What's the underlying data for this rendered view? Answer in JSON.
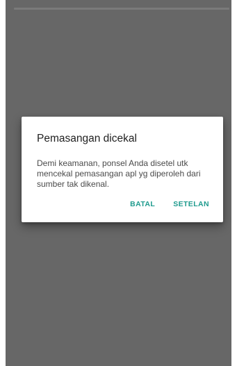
{
  "dialog": {
    "title": "Pemasangan dicekal",
    "message": "Demi keamanan, ponsel Anda disetel utk mencekal pemasangan apl yg diperoleh dari sumber tak dikenal.",
    "cancel_label": "BATAL",
    "settings_label": "SETELAN"
  },
  "colors": {
    "scrim": "#676767",
    "accent": "#1f9b8e",
    "dialog_bg": "#ffffff"
  }
}
